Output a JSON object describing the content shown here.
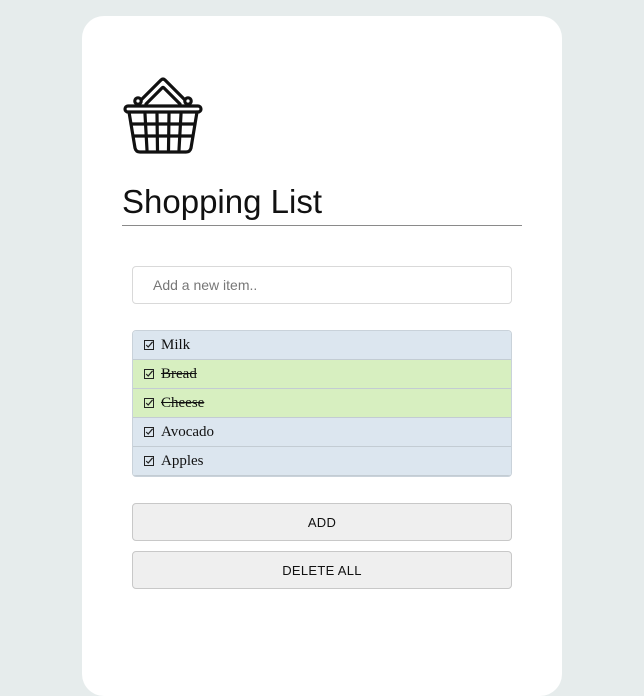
{
  "header": {
    "icon": "shopping-basket-icon",
    "title": "Shopping List"
  },
  "input": {
    "placeholder": "Add a new item.."
  },
  "list": {
    "items": [
      {
        "label": "Milk",
        "done": false
      },
      {
        "label": "Bread",
        "done": true
      },
      {
        "label": "Cheese",
        "done": true
      },
      {
        "label": "Avocado",
        "done": false
      },
      {
        "label": "Apples",
        "done": false
      }
    ]
  },
  "buttons": {
    "add_label": "ADD",
    "delete_all_label": "DELETE ALL"
  },
  "colors": {
    "background": "#e6ecec",
    "card": "#ffffff",
    "item_pending": "#dce6ef",
    "item_done": "#d7efc0"
  }
}
